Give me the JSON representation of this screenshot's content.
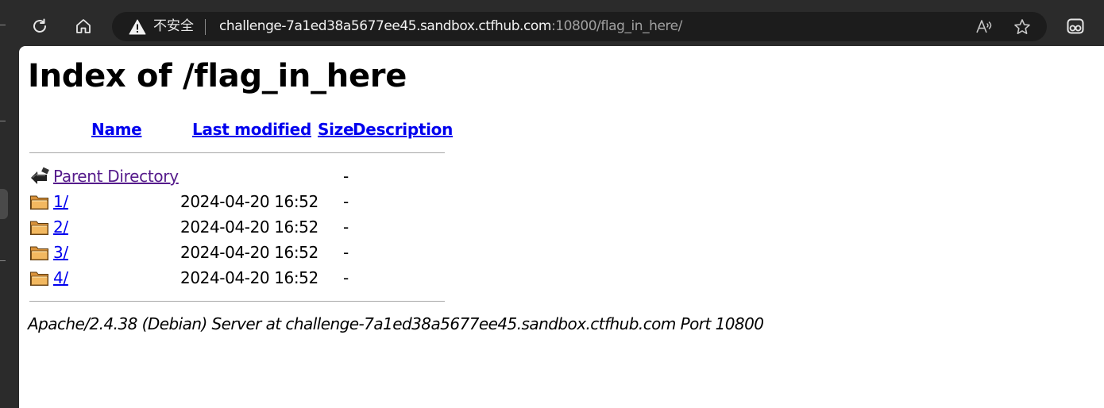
{
  "browser": {
    "security_label": "不安全",
    "url_host": "challenge-7a1ed38a5677ee45.sandbox.ctfhub.com",
    "url_rest": ":10800/flag_in_here/",
    "icons": [
      "reload-icon",
      "home-icon",
      "warning-icon",
      "read-aloud-icon",
      "favorite-star-icon",
      "extension-icon"
    ]
  },
  "page": {
    "title": "Index of /flag_in_here",
    "columns": {
      "name": "Name",
      "last_modified": "Last modified",
      "size": "Size",
      "description": "Description"
    },
    "entries": [
      {
        "icon": "back-arrow-icon",
        "name": "Parent Directory",
        "modified": "",
        "size": "-",
        "visited": true
      },
      {
        "icon": "folder-icon",
        "name": "1/",
        "modified": "2024-04-20 16:52",
        "size": "-",
        "visited": false
      },
      {
        "icon": "folder-icon",
        "name": "2/",
        "modified": "2024-04-20 16:52",
        "size": "-",
        "visited": false
      },
      {
        "icon": "folder-icon",
        "name": "3/",
        "modified": "2024-04-20 16:52",
        "size": "-",
        "visited": false
      },
      {
        "icon": "folder-icon",
        "name": "4/",
        "modified": "2024-04-20 16:52",
        "size": "-",
        "visited": false
      }
    ],
    "footer": "Apache/2.4.38 (Debian) Server at challenge-7a1ed38a5677ee45.sandbox.ctfhub.com Port 10800"
  },
  "colors": {
    "chrome_bg": "#2b2b2b",
    "address_bg": "#1c1c1c",
    "link": "#0000ee",
    "visited_link": "#551a8b"
  }
}
